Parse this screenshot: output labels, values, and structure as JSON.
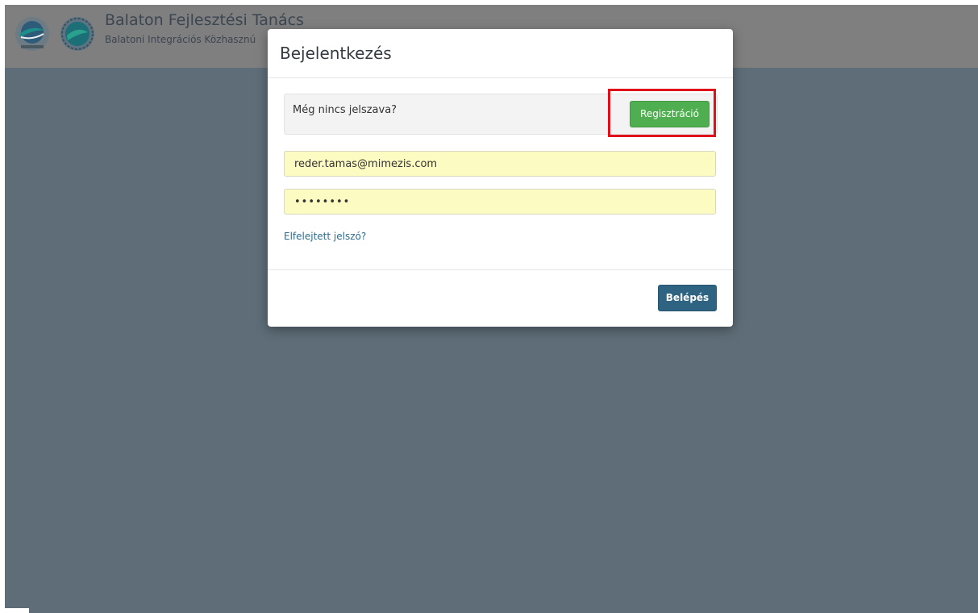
{
  "header": {
    "title": "Balaton Fejlesztési Tanács",
    "subtitle": "Balatoni Integrációs Közhasznú"
  },
  "modal": {
    "title": "Bejelentkezés",
    "register_prompt": "Még nincs jelszava?",
    "register_button": "Regisztráció",
    "email_value": "reder.tamas@mimezis.com",
    "password_value": "••••••••",
    "forgot_link": "Elfelejtett jelszó?",
    "login_button": "Belépés"
  },
  "colors": {
    "overlay": "#5e6d78",
    "header_bg": "#7f7f7f",
    "register_green": "#4fae4f",
    "login_blue": "#2e6481",
    "highlight_red": "#e0101a",
    "input_autofill": "#fbfbc2"
  },
  "icons": [
    "balaton-logo-icon",
    "integration-logo-icon"
  ]
}
